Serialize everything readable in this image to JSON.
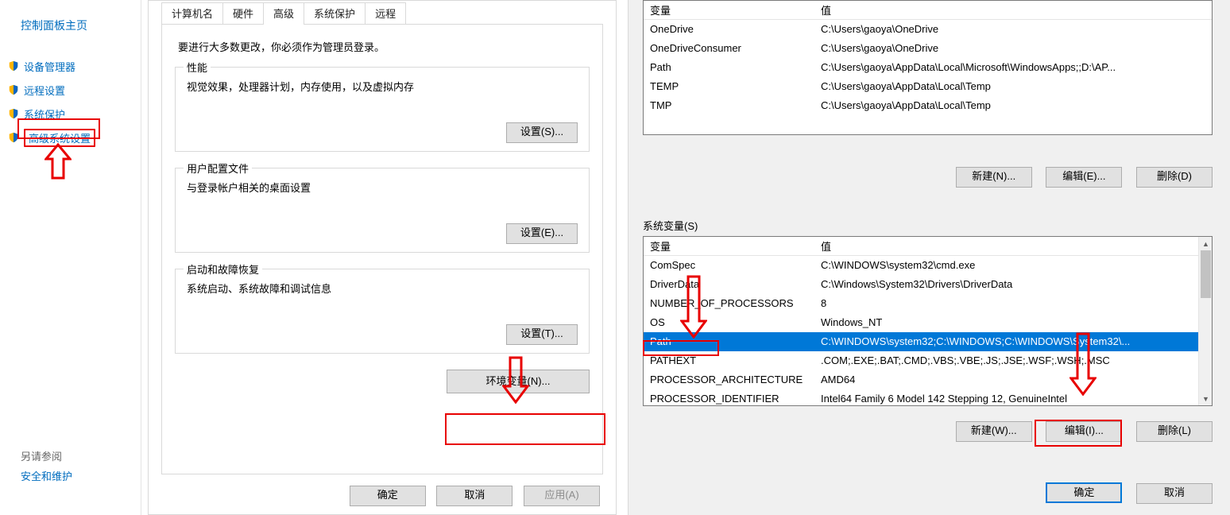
{
  "cp": {
    "home": "控制面板主页",
    "links": [
      "设备管理器",
      "远程设置",
      "系统保护",
      "高级系统设置"
    ],
    "seeAlsoLabel": "另请参阅",
    "seeAlso": "安全和维护"
  },
  "sysprops": {
    "tabs": [
      "计算机名",
      "硬件",
      "高级",
      "系统保护",
      "远程"
    ],
    "activeTab": 2,
    "note": "要进行大多数更改，你必须作为管理员登录。",
    "perf": {
      "label": "性能",
      "desc": "视觉效果，处理器计划，内存使用，以及虚拟内存",
      "btn": "设置(S)..."
    },
    "profile": {
      "label": "用户配置文件",
      "desc": "与登录帐户相关的桌面设置",
      "btn": "设置(E)..."
    },
    "startup": {
      "label": "启动和故障恢复",
      "desc": "系统启动、系统故障和调试信息",
      "btn": "设置(T)..."
    },
    "envBtn": "环境变量(N)...",
    "ok": "确定",
    "cancel": "取消",
    "apply": "应用(A)"
  },
  "env": {
    "colVar": "变量",
    "colVal": "值",
    "userVars": [
      {
        "n": "OneDrive",
        "v": "C:\\Users\\gaoya\\OneDrive"
      },
      {
        "n": "OneDriveConsumer",
        "v": "C:\\Users\\gaoya\\OneDrive"
      },
      {
        "n": "Path",
        "v": "C:\\Users\\gaoya\\AppData\\Local\\Microsoft\\WindowsApps;;D:\\AP..."
      },
      {
        "n": "TEMP",
        "v": "C:\\Users\\gaoya\\AppData\\Local\\Temp"
      },
      {
        "n": "TMP",
        "v": "C:\\Users\\gaoya\\AppData\\Local\\Temp"
      }
    ],
    "userBtns": {
      "new": "新建(N)...",
      "edit": "编辑(E)...",
      "del": "删除(D)"
    },
    "sysLabel": "系统变量(S)",
    "sysVars": [
      {
        "n": "ComSpec",
        "v": "C:\\WINDOWS\\system32\\cmd.exe"
      },
      {
        "n": "DriverData",
        "v": "C:\\Windows\\System32\\Drivers\\DriverData"
      },
      {
        "n": "NUMBER_OF_PROCESSORS",
        "v": "8"
      },
      {
        "n": "OS",
        "v": "Windows_NT"
      },
      {
        "n": "Path",
        "v": "C:\\WINDOWS\\system32;C:\\WINDOWS;C:\\WINDOWS\\System32\\...",
        "sel": true
      },
      {
        "n": "PATHEXT",
        "v": ".COM;.EXE;.BAT;.CMD;.VBS;.VBE;.JS;.JSE;.WSF;.WSH;.MSC"
      },
      {
        "n": "PROCESSOR_ARCHITECTURE",
        "v": "AMD64"
      },
      {
        "n": "PROCESSOR_IDENTIFIER",
        "v": "Intel64 Family 6 Model 142 Stepping 12, GenuineIntel"
      }
    ],
    "sysBtns": {
      "new": "新建(W)...",
      "edit": "编辑(I)...",
      "del": "删除(L)"
    },
    "ok": "确定",
    "cancel": "取消"
  }
}
